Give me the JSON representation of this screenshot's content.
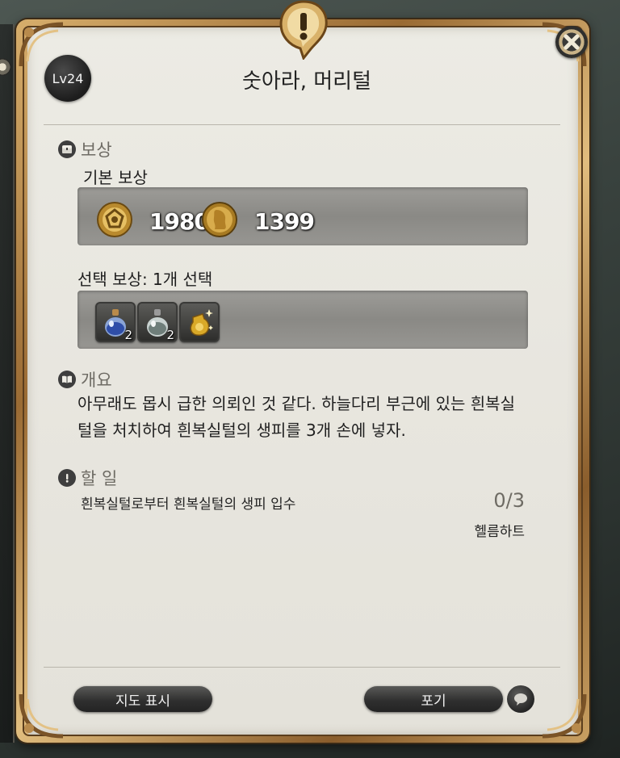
{
  "quest": {
    "level": "Lv24",
    "title": "숫아라, 머리털"
  },
  "rewards": {
    "heading": "보상",
    "base_label": "기본 보상",
    "base": [
      {
        "icon": "seal-currency-icon",
        "value": "1980"
      },
      {
        "icon": "gil-coin-icon",
        "value": "1399"
      }
    ],
    "choice_label": "선택 보상: 1개 선택",
    "choices": [
      {
        "icon": "blue-potion-icon",
        "count": "2"
      },
      {
        "icon": "clear-potion-icon",
        "count": "2"
      },
      {
        "icon": "gold-pouch-icon",
        "count": ""
      }
    ]
  },
  "summary": {
    "heading": "개요",
    "text": "아무래도 몹시 급한 의뢰인 것 같다. 하늘다리 부근에 있는 흰복실털을 처치하여 흰복실털의 생피를 3개 손에 넣자."
  },
  "todo": {
    "heading": "할 일",
    "objective": "흰복실털로부터 흰복실털의 생피 입수",
    "progress": "0/3",
    "location": "헬름하트"
  },
  "buttons": {
    "map": "지도 표시",
    "abandon": "포기"
  },
  "colors": {
    "frame_gold": "#c9a062",
    "parchment": "#e8e6df",
    "reward_bar": "#8f8e8a",
    "button_dark": "#2b2b2b"
  }
}
